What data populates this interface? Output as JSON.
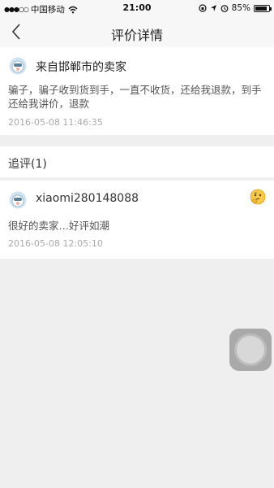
{
  "status_bar": {
    "carrier": "中国移动",
    "time": "21:00",
    "battery": "85%",
    "battery_level": 0.85
  },
  "nav": {
    "title": "评价详情"
  },
  "review": {
    "seller": "来自邯郸市的卖家",
    "text": "骗子，骗子收到货到手，一直不收货，还给我退款，到手还给我讲价，退款",
    "time": "2016-05-08 11:46:35"
  },
  "followup": {
    "title": "追评(1)",
    "user": "xiaomi280148088",
    "text": "很好的卖家…好评如潮",
    "time": "2016-05-08 12:05:10"
  },
  "colors": {
    "background": "#efefef",
    "card": "#ffffff",
    "timestamp": "#aaaaaa"
  }
}
